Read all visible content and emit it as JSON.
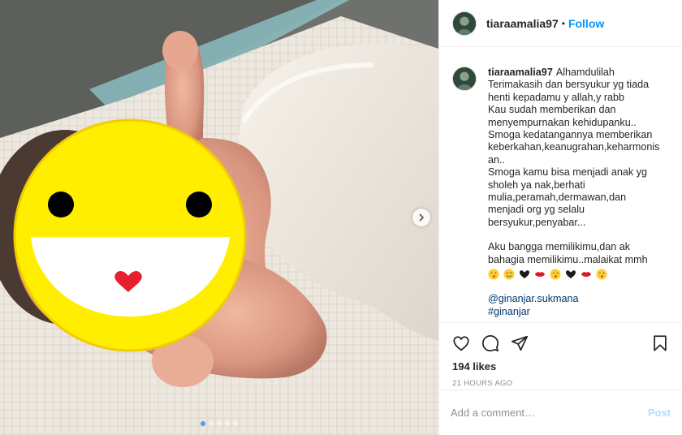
{
  "post": {
    "username": "tiaraamalia97",
    "separator": "•",
    "follow_label": "Follow",
    "caption_lines": [
      "Terimakasih dan bersyukur yg tiada",
      "henti kepadamu y allah,y rabb",
      "Kau sudah memberikan dan",
      "menyempurnakan kehidupanku..",
      "Smoga kedatangannya memberikan",
      "keberkahan,keanugrahan,keharmonis",
      "an..",
      "Smoga kamu bisa menjadi anak yg",
      "sholeh ya nak,berhati",
      "mulia,peramah,dermawan,dan",
      "menjadi org yg selalu",
      "bersyukur,penyabar..."
    ],
    "caption_first": "Alhamdulilah",
    "caption_lines2": [
      "Aku bangga memilikimu,dan ak",
      "bahagia memilikimu..malaikat mmh"
    ],
    "emoji_sequence": [
      "kiss-face",
      "smile-face",
      "black-heart",
      "kiss-lips",
      "kiss-face",
      "black-heart",
      "kiss-lips",
      "kiss-face"
    ],
    "mention": "@ginanjar.sukmana",
    "hashtag": "#ginanjar",
    "likes": "194 likes",
    "timestamp": "21 HOURS AGO",
    "comment_placeholder": "Add a comment…",
    "post_label": "Post",
    "carousel": {
      "slides": 5,
      "active": 1
    }
  },
  "colors": {
    "link_blue": "#0095f6",
    "post_disabled": "#b2dffc",
    "emoji_yellow": "#ffee00",
    "lips_red": "#e8202e"
  }
}
